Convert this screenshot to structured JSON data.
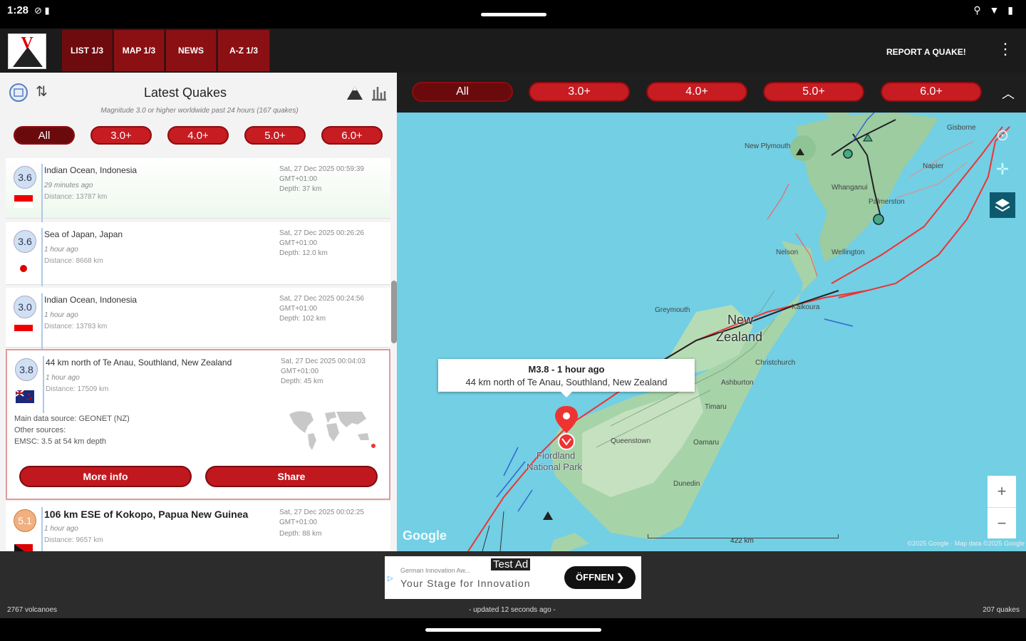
{
  "status_bar": {
    "time": "1:28",
    "icons_left": "⊘ ▮",
    "icons_right": "⚲ ▼ ▮"
  },
  "app_bar": {
    "tabs": [
      {
        "label": "LIST 1/3",
        "active": true
      },
      {
        "label": "MAP 1/3"
      },
      {
        "label": "NEWS"
      },
      {
        "label": "A-Z 1/3"
      }
    ],
    "refresh_icon": "refresh-icon",
    "filter_icon": "filter-icon",
    "report_label": "REPORT A QUAKE!",
    "menu_icon": "more-vert-icon"
  },
  "list_panel": {
    "title": "Latest Quakes",
    "subtitle": "Magnitude 3.0 or higher worldwide past 24 hours (167 quakes)",
    "filters": [
      "All",
      "3.0+",
      "4.0+",
      "5.0+",
      "6.0+"
    ],
    "quakes": [
      {
        "mag": "3.6",
        "location": "Indian Ocean, Indonesia",
        "ago": "29 minutes ago",
        "distance": "Distance: 13787 km",
        "date": "Sat, 27 Dec 2025 00:59:39",
        "tz": "GMT+01:00",
        "depth": "Depth: 37 km",
        "flag": "indonesia"
      },
      {
        "mag": "3.6",
        "location": "Sea of Japan, Japan",
        "ago": "1 hour ago",
        "distance": "Distance: 8668 km",
        "date": "Sat, 27 Dec 2025 00:26:26",
        "tz": "GMT+01:00",
        "depth": "Depth: 12.0 km",
        "flag": "japan"
      },
      {
        "mag": "3.0",
        "location": "Indian Ocean, Indonesia",
        "ago": "1 hour ago",
        "distance": "Distance: 13783 km",
        "date": "Sat, 27 Dec 2025 00:24:56",
        "tz": "GMT+01:00",
        "depth": "Depth: 102 km",
        "flag": "indonesia"
      },
      {
        "mag": "3.8",
        "location": "44 km north of Te Anau, Southland, New Zealand",
        "ago": "1 hour ago",
        "distance": "Distance: 17509 km",
        "date": "Sat, 27 Dec 2025 00:04:03",
        "tz": "GMT+01:00",
        "depth": "Depth: 45 km",
        "flag": "new-zealand",
        "source_main": "Main data source: GEONET (NZ)",
        "source_other": "Other sources:",
        "source_emsc": "EMSC: 3.5 at 54 km depth",
        "more_info": "More info",
        "share": "Share"
      },
      {
        "mag": "5.1",
        "location": "106 km ESE of Kokopo, Papua New Guinea",
        "ago": "1 hour ago",
        "distance": "Distance: 9657 km",
        "date": "Sat, 27 Dec 2025 00:02:25",
        "tz": "GMT+01:00",
        "depth": "Depth: 88 km",
        "flag": "png"
      }
    ]
  },
  "map_panel": {
    "filters": [
      "All",
      "3.0+",
      "4.0+",
      "5.0+",
      "6.0+"
    ],
    "popup_title": "M3.8  -  1 hour ago",
    "popup_location": "44 km north of Te Anau, Southland, New Zealand",
    "country_label_1": "New",
    "country_label_2": "Zealand",
    "place_labels": {
      "new_plymouth": "New Plymouth",
      "napier": "Napier",
      "whanganui": "Whanganui",
      "palmerston": "Palmerston",
      "wellington": "Wellington",
      "nelson": "Nelson",
      "greymouth": "Greymouth",
      "kaikoura": "Kaikoura",
      "christchurch": "Christchurch",
      "ashburton": "Ashburton",
      "timaru": "Timaru",
      "oamaru": "Oamaru",
      "dunedin": "Dunedin",
      "queenstown": "Queenstown",
      "fiordland": "Fiordland",
      "national_park": "National Park",
      "gisborne": "Gisborne"
    },
    "scale_label": "422 km",
    "google_logo": "Google",
    "copyright": "©2025 Google · Map data ©2025 Google",
    "zoom_in": "+",
    "zoom_out": "−"
  },
  "ad": {
    "tag": "Test Ad",
    "small": "German Innovation Aw...",
    "headline": "Your Stage for Innovation",
    "button": "ÖFFNEN ❯"
  },
  "footer": {
    "left": "2767 volcanoes",
    "center": "- updated 12 seconds ago -",
    "right": "207 quakes"
  }
}
